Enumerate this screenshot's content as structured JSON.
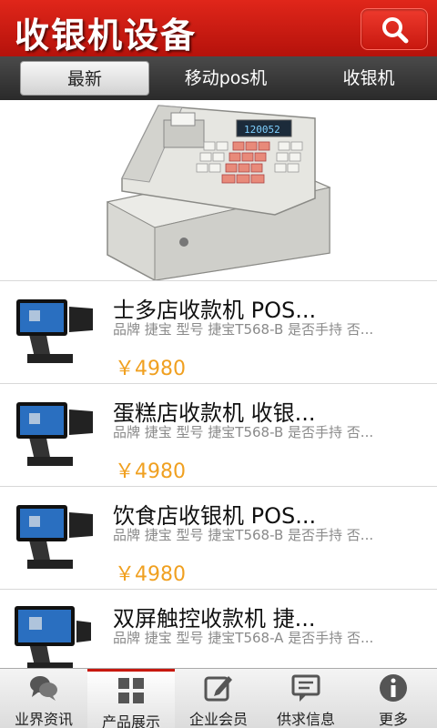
{
  "header": {
    "title": "收银机设备",
    "search_icon": "search-icon"
  },
  "tabs": [
    {
      "label": "最新",
      "active": true
    },
    {
      "label": "移动pos机",
      "active": false
    },
    {
      "label": "收银机",
      "active": false
    }
  ],
  "hero": {
    "display_digits": "120052"
  },
  "products": [
    {
      "title": "士多店收款机 POS...",
      "desc": "品牌 捷宝 型号 捷宝T568-B 是否手持 否...",
      "price": "￥4980"
    },
    {
      "title": "蛋糕店收款机 收银...",
      "desc": "品牌 捷宝 型号 捷宝T568-B 是否手持 否...",
      "price": "￥4980"
    },
    {
      "title": "饮食店收银机 POS...",
      "desc": "品牌 捷宝 型号 捷宝T568-B 是否手持 否...",
      "price": "￥4980"
    },
    {
      "title": "双屏触控收款机 捷...",
      "desc": "品牌 捷宝 型号 捷宝T568-A 是否手持 否...",
      "price": ""
    }
  ],
  "bottom_nav": [
    {
      "label": "业界资讯",
      "icon": "chat-bubbles-icon",
      "active": false
    },
    {
      "label": "产品展示",
      "icon": "grid-icon",
      "active": true
    },
    {
      "label": "企业会员",
      "icon": "edit-icon",
      "active": false
    },
    {
      "label": "供求信息",
      "icon": "message-icon",
      "active": false
    },
    {
      "label": "更多",
      "icon": "info-icon",
      "active": false
    }
  ],
  "colors": {
    "header_red": "#c8180f",
    "price_orange": "#f0a020",
    "tab_bar": "#333333"
  }
}
